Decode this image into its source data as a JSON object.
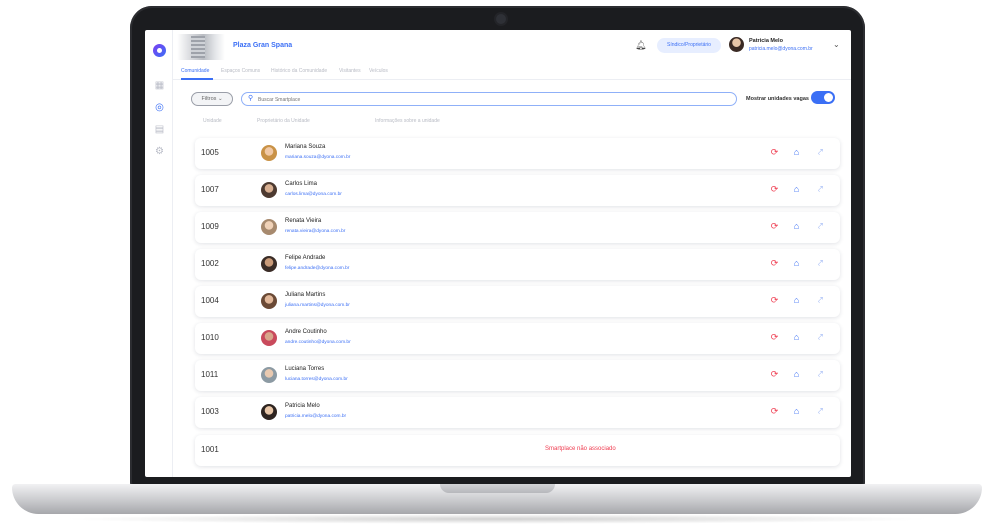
{
  "app": {
    "condominium": "Plaza Gran Spana",
    "role_badge": "Síndico/Proprietário",
    "user_name": "Patricia Melo",
    "user_email": "patricia.melo@dyona.com.br"
  },
  "tabs": [
    {
      "label": "Comunidade",
      "active": true
    },
    {
      "label": "Espaços Comuns",
      "active": false
    },
    {
      "label": "Histórico da Comunidade",
      "active": false
    },
    {
      "label": "Visitantes",
      "active": false
    },
    {
      "label": "Veículos",
      "active": false
    }
  ],
  "toolbar": {
    "filters_label": "Filtros",
    "search_placeholder": "Buscar Smartplace",
    "vacant_label": "Mostrar unidades vagas",
    "vacant_toggle_on": true
  },
  "table": {
    "headers": [
      "Unidade",
      "Proprietário da Unidade",
      "Informações sobre a unidade"
    ],
    "rows": [
      {
        "unit": "1005",
        "name": "Mariana Souza",
        "email": "mariana.souza@dyona.com.br"
      },
      {
        "unit": "1007",
        "name": "Carlos Lima",
        "email": "carlos.lima@dyona.com.br"
      },
      {
        "unit": "1009",
        "name": "Renata Vieira",
        "email": "renata.vieira@dyona.com.br"
      },
      {
        "unit": "1002",
        "name": "Felipe Andrade",
        "email": "felipe.andrade@dyona.com.br"
      },
      {
        "unit": "1004",
        "name": "Juliana Martins",
        "email": "juliana.martins@dyona.com.br"
      },
      {
        "unit": "1010",
        "name": "Andre Coutinho",
        "email": "andre.coutinho@dyona.com.br"
      },
      {
        "unit": "1011",
        "name": "Luciana Torres",
        "email": "luciana.torres@dyona.com.br"
      },
      {
        "unit": "1003",
        "name": "Patricia Melo",
        "email": "patricia.melo@dyona.com.br"
      }
    ],
    "unassociated": {
      "unit": "1001",
      "message": "Smartplace não associado"
    }
  },
  "colors": {
    "accent": "#3b6ff5",
    "danger": "#ef3b4f"
  },
  "icons": [
    "logo-icon",
    "grid-icon",
    "community-icon",
    "building-icon",
    "settings-icon",
    "bell-icon",
    "search-icon",
    "sync-icon",
    "home-icon",
    "link-icon",
    "chevron-down-icon"
  ]
}
